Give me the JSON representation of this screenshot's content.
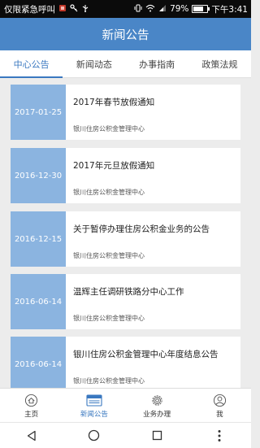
{
  "status": {
    "carrier": "仅限紧急呼叫",
    "battery": "79%",
    "time": "下午3:41"
  },
  "appbar": {
    "title": "新闻公告"
  },
  "tabs": [
    {
      "label": "中心公告",
      "active": true
    },
    {
      "label": "新闻动态",
      "active": false
    },
    {
      "label": "办事指南",
      "active": false
    },
    {
      "label": "政策法规",
      "active": false
    }
  ],
  "items": [
    {
      "date": "2017-01-25",
      "title": "2017年春节放假通知",
      "source": "银川住房公积金管理中心"
    },
    {
      "date": "2016-12-30",
      "title": "2017年元旦放假通知",
      "source": "银川住房公积金管理中心"
    },
    {
      "date": "2016-12-15",
      "title": "关于暂停办理住房公积金业务的公告",
      "source": "银川住房公积金管理中心"
    },
    {
      "date": "2016-06-14",
      "title": "温辉主任调研铁路分中心工作",
      "source": "银川住房公积金管理中心"
    },
    {
      "date": "2016-06-14",
      "title": "银川住房公积金管理中心年度结息公告",
      "source": "银川住房公积金管理中心"
    }
  ],
  "bottom_nav": [
    {
      "label": "主页",
      "icon": "home-icon"
    },
    {
      "label": "新闻公告",
      "icon": "news-icon",
      "active": true
    },
    {
      "label": "业务办理",
      "icon": "gear-icon"
    },
    {
      "label": "我",
      "icon": "user-icon"
    }
  ],
  "colors": {
    "primary": "#4a86c7",
    "date_block": "#8bb4e0",
    "active_tab": "#3a78c0"
  }
}
